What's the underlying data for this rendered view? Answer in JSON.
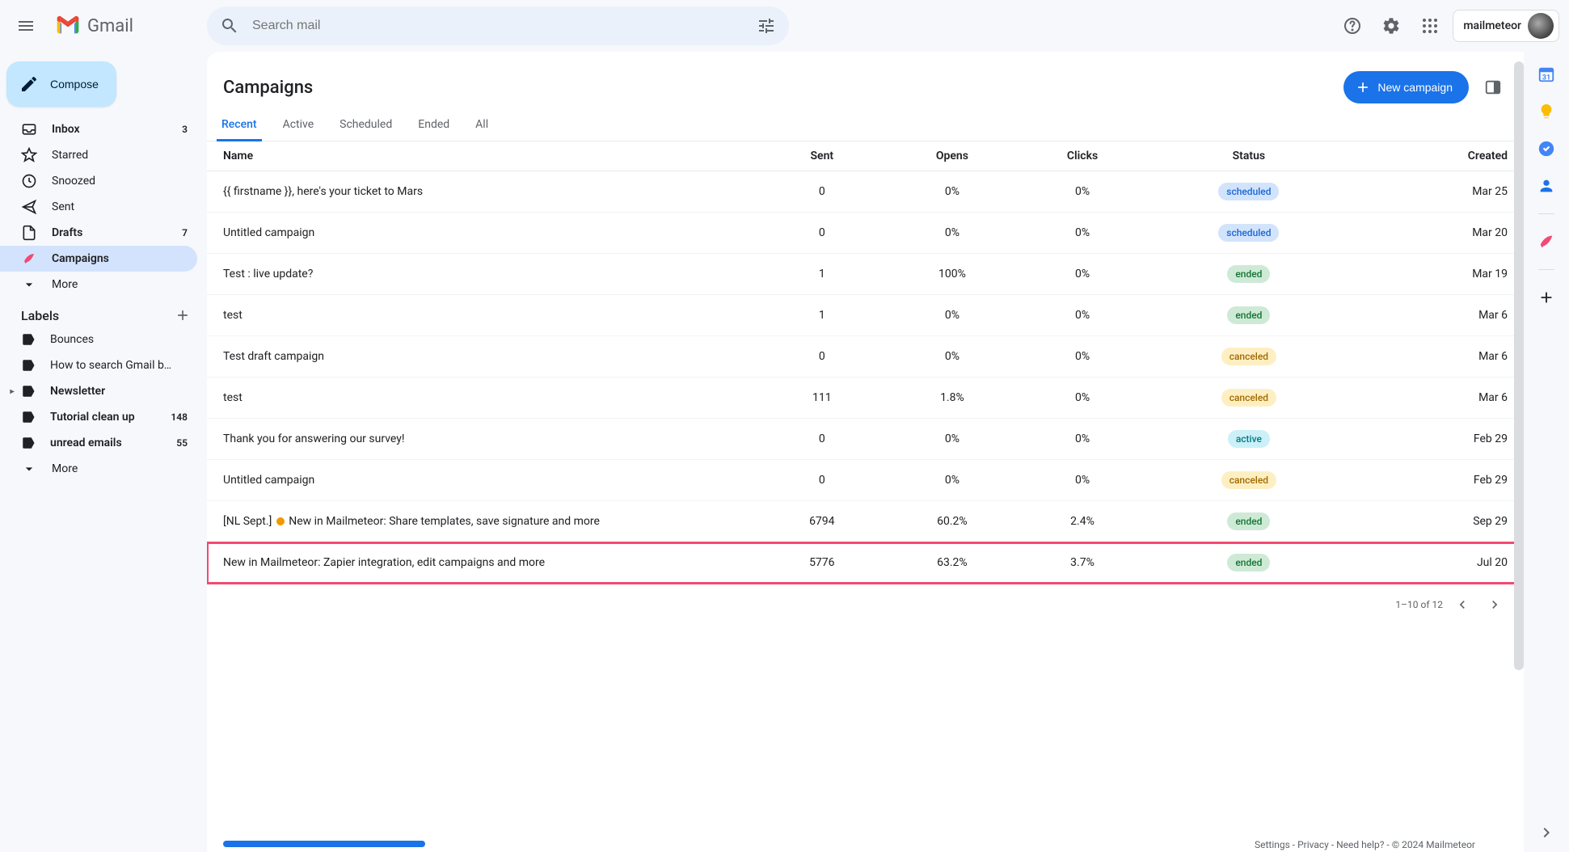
{
  "logo_text": "Gmail",
  "search_placeholder": "Search mail",
  "account_name": "mailmeteor",
  "compose_label": "Compose",
  "nav": [
    {
      "key": "inbox",
      "label": "Inbox",
      "count": "3",
      "bold": true
    },
    {
      "key": "starred",
      "label": "Starred",
      "count": "",
      "bold": false
    },
    {
      "key": "snoozed",
      "label": "Snoozed",
      "count": "",
      "bold": false
    },
    {
      "key": "sent",
      "label": "Sent",
      "count": "",
      "bold": false
    },
    {
      "key": "drafts",
      "label": "Drafts",
      "count": "7",
      "bold": true
    },
    {
      "key": "campaigns",
      "label": "Campaigns",
      "count": "",
      "bold": true,
      "active": true
    },
    {
      "key": "more",
      "label": "More",
      "count": "",
      "bold": false
    }
  ],
  "labels_header": "Labels",
  "labels": [
    {
      "label": "Bounces",
      "count": "",
      "bold": false,
      "caret": false
    },
    {
      "label": "How to search Gmail by ...",
      "count": "",
      "bold": false,
      "caret": false
    },
    {
      "label": "Newsletter",
      "count": "",
      "bold": true,
      "caret": true
    },
    {
      "label": "Tutorial clean up",
      "count": "148",
      "bold": true,
      "caret": false
    },
    {
      "label": "unread emails",
      "count": "55",
      "bold": true,
      "caret": false
    },
    {
      "label": "More",
      "count": "",
      "bold": false,
      "caret": false,
      "more": true
    }
  ],
  "page_title": "Campaigns",
  "new_campaign_label": "New campaign",
  "tabs": [
    "Recent",
    "Active",
    "Scheduled",
    "Ended",
    "All"
  ],
  "active_tab": "Recent",
  "columns": {
    "name": "Name",
    "sent": "Sent",
    "opens": "Opens",
    "clicks": "Clicks",
    "status": "Status",
    "created": "Created"
  },
  "rows": [
    {
      "name": "{{ firstname }}, here's your ticket to Mars",
      "sent": "0",
      "opens": "0%",
      "clicks": "0%",
      "status": "scheduled",
      "created": "Mar 25"
    },
    {
      "name": "Untitled campaign",
      "sent": "0",
      "opens": "0%",
      "clicks": "0%",
      "status": "scheduled",
      "created": "Mar 20"
    },
    {
      "name": "Test : live update?",
      "sent": "1",
      "opens": "100%",
      "clicks": "0%",
      "status": "ended",
      "created": "Mar 19"
    },
    {
      "name": "test",
      "sent": "1",
      "opens": "0%",
      "clicks": "0%",
      "status": "ended",
      "created": "Mar 6"
    },
    {
      "name": "Test draft campaign",
      "sent": "0",
      "opens": "0%",
      "clicks": "0%",
      "status": "canceled",
      "created": "Mar 6"
    },
    {
      "name": "test",
      "sent": "111",
      "opens": "1.8%",
      "clicks": "0%",
      "status": "canceled",
      "created": "Mar 6"
    },
    {
      "name": "Thank you for answering our survey!",
      "sent": "0",
      "opens": "0%",
      "clicks": "0%",
      "status": "active",
      "created": "Feb 29"
    },
    {
      "name": "Untitled campaign",
      "sent": "0",
      "opens": "0%",
      "clicks": "0%",
      "status": "canceled",
      "created": "Feb 29"
    },
    {
      "name_prefix": "[NL Sept.] ",
      "name_suffix": " New in Mailmeteor: Share templates, save signature and more",
      "has_dot": true,
      "sent": "6794",
      "opens": "60.2%",
      "clicks": "2.4%",
      "status": "ended",
      "created": "Sep 29"
    },
    {
      "name": "New in Mailmeteor: Zapier integration, edit campaigns and more",
      "sent": "5776",
      "opens": "63.2%",
      "clicks": "3.7%",
      "status": "ended",
      "created": "Jul 20",
      "highlight": true
    }
  ],
  "pagination": "1–10 of 12",
  "footer_links": "Settings - Privacy - Need help? - © 2024 Mailmeteor"
}
